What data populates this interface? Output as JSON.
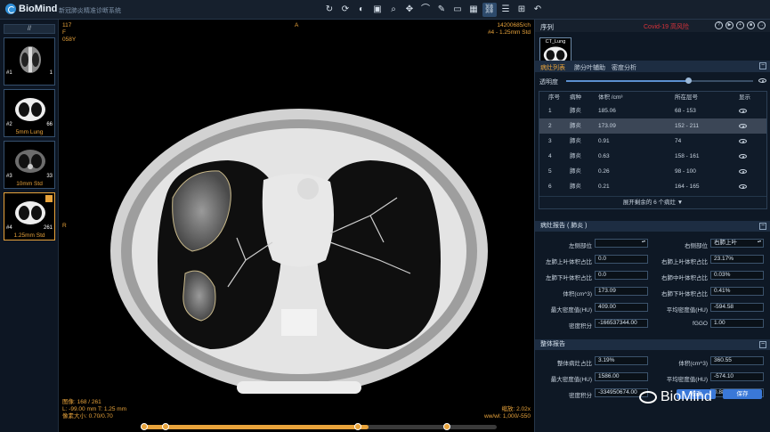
{
  "app": {
    "name": "BioMind",
    "subtitle": "新冠肺炎精准诊断系统"
  },
  "toolbar": [
    "↻",
    "⟳",
    "◐",
    "▣",
    "⌕",
    "✥",
    "⌒",
    "✎",
    "▭",
    "▦",
    "⛓",
    "☰",
    "⊞",
    "↶"
  ],
  "series_switch": "//",
  "thumbnails": [
    {
      "corner_l": "#1",
      "corner_r": "1",
      "label": ""
    },
    {
      "corner_l": "#2",
      "corner_r": "66",
      "label": "5mm Lung"
    },
    {
      "corner_l": "#3",
      "corner_r": "33",
      "label": "10mm Std"
    },
    {
      "corner_l": "#4",
      "corner_r": "261",
      "label": "1.25mm Std"
    }
  ],
  "viewer": {
    "top_left": [
      "117",
      "F",
      "058Y"
    ],
    "top_center": "A",
    "top_right": [
      "14200685/ch",
      "#4 - 1.25mm Std"
    ],
    "left_marker": "R",
    "bottom_left": [
      "图像: 168 / 261",
      "L: -99.00 mm T: 1.25 mm",
      "像素大小: 0.70/0.70"
    ],
    "bottom_right": [
      "缩放: 2.02x",
      "ww/wl: 1,000/-550"
    ],
    "slider_progress": 0.64
  },
  "sequence": {
    "title": "序列",
    "status": "Covid-19 高风险",
    "thumb_label": "CT_Lung",
    "controls": [
      "?",
      "▶",
      "+",
      "■",
      "→"
    ]
  },
  "tabs": [
    "病灶列表",
    "肺分叶辅助",
    "密度分析"
  ],
  "opacity": {
    "label": "透明度",
    "value": 0.65
  },
  "lesion_table": {
    "headers": [
      "序号",
      "病种",
      "体积 /cm³",
      "所在层号",
      "显示"
    ],
    "rows": [
      {
        "no": "1",
        "type": "肺炎",
        "volume": "185.06",
        "slices": "68 - 153"
      },
      {
        "no": "2",
        "type": "肺炎",
        "volume": "173.09",
        "slices": "152 - 211"
      },
      {
        "no": "3",
        "type": "肺炎",
        "volume": "0.91",
        "slices": "74"
      },
      {
        "no": "4",
        "type": "肺炎",
        "volume": "0.63",
        "slices": "158 - 161"
      },
      {
        "no": "5",
        "type": "肺炎",
        "volume": "0.26",
        "slices": "98 - 100"
      },
      {
        "no": "6",
        "type": "肺炎",
        "volume": "0.21",
        "slices": "164 - 165"
      }
    ],
    "expand": "展开剩余的 6 个病灶 ▼"
  },
  "report": {
    "title": "病灶报告 ( 肺炎 )",
    "left": [
      {
        "label": "左侧部位",
        "value": ""
      },
      {
        "label": "左肺上叶体积占比",
        "value": "0.0"
      },
      {
        "label": "左肺下叶体积占比",
        "value": "0.0"
      },
      {
        "label": "体积(cm^3)",
        "value": "173.09"
      },
      {
        "label": "最大密度值(HU)",
        "value": "409.00"
      },
      {
        "label": "密度积分",
        "value": "-166537344.00"
      }
    ],
    "right": [
      {
        "label": "右侧部位",
        "value": "右肺上叶"
      },
      {
        "label": "右肺上叶体积占比",
        "value": "23.17%"
      },
      {
        "label": "右肺中叶体积占比",
        "value": "0.03%"
      },
      {
        "label": "右肺下叶体积占比",
        "value": "0.41%"
      },
      {
        "label": "平均密度值(HU)",
        "value": "-594.58"
      },
      {
        "label": "fGGO",
        "value": "1.00"
      }
    ]
  },
  "overall": {
    "title": "整体报告",
    "left": [
      {
        "label": "整体病灶占比",
        "value": "3.19%"
      },
      {
        "label": "最大密度值(HU)",
        "value": "1586.00"
      },
      {
        "label": "密度积分",
        "value": "-334950674.00"
      }
    ],
    "right": [
      {
        "label": "体积(cm^3)",
        "value": "360.55"
      },
      {
        "label": "平均密度值(HU)",
        "value": "-574.10"
      },
      {
        "label": "fGGO",
        "value": "0.88"
      }
    ]
  },
  "buttons": {
    "modify": "修改",
    "save": "保存"
  },
  "watermark": "BioMind"
}
